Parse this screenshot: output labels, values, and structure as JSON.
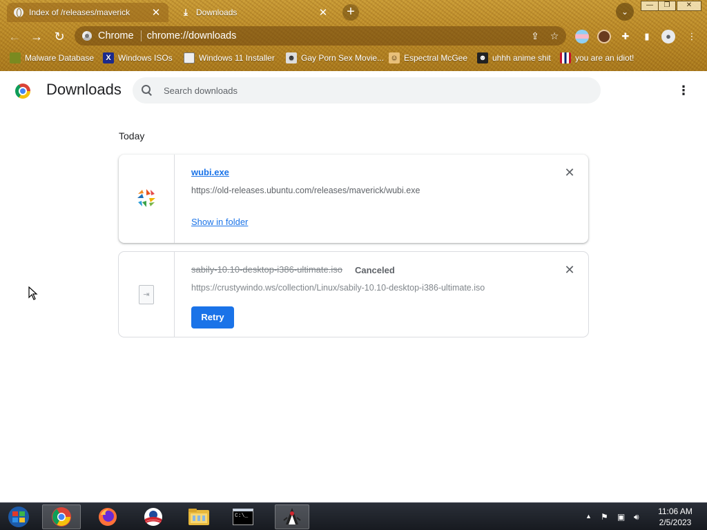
{
  "browser": {
    "tabs": [
      {
        "title": "Index of /releases/maverick",
        "icon": "globe-icon",
        "active": true
      },
      {
        "title": "Downloads",
        "icon": "download-icon",
        "active": false
      }
    ],
    "new_tab_label": "+",
    "omnibox": {
      "site_label": "Chrome",
      "url": "chrome://downloads"
    },
    "bookmarks": [
      {
        "label": "Malware Database",
        "icon": "leaf-icon"
      },
      {
        "label": "Windows ISOs",
        "icon": "x-logo-icon"
      },
      {
        "label": "Windows 11 Installer",
        "icon": "image-icon"
      },
      {
        "label": "Gay Porn Sex Movie...",
        "icon": "mascot-icon"
      },
      {
        "label": "Espectral McGee",
        "icon": "character-icon"
      },
      {
        "label": "uhhh anime shit",
        "icon": "anime-icon"
      },
      {
        "label": "you are an idiot!",
        "icon": "flag-icon"
      }
    ]
  },
  "page": {
    "title": "Downloads",
    "search_placeholder": "Search downloads",
    "section_label": "Today",
    "downloads": [
      {
        "filename": "wubi.exe",
        "url": "https://old-releases.ubuntu.com/releases/maverick/wubi.exe",
        "action": "Show in folder",
        "status": "",
        "icon": "ubuntu-logo-icon"
      },
      {
        "filename": "sabily-10.10-desktop-i386-ultimate.iso",
        "url": "https://crustywindo.ws/collection/Linux/sabily-10.10-desktop-i386-ultimate.iso",
        "action": "Retry",
        "status": "Canceled",
        "icon": "generic-file-icon"
      }
    ]
  },
  "taskbar": {
    "apps": [
      {
        "name": "start-button"
      },
      {
        "name": "chrome-app",
        "active": true
      },
      {
        "name": "firefox-app"
      },
      {
        "name": "obama-app"
      },
      {
        "name": "file-explorer-app"
      },
      {
        "name": "cmd-app",
        "label": "C:\\_"
      },
      {
        "name": "java-app"
      }
    ],
    "time": "11:06 AM",
    "date": "2/5/2023"
  },
  "colors": {
    "accent": "#1a73e8",
    "theme_gold": "#b98826",
    "taskbar": "#1d2027"
  }
}
